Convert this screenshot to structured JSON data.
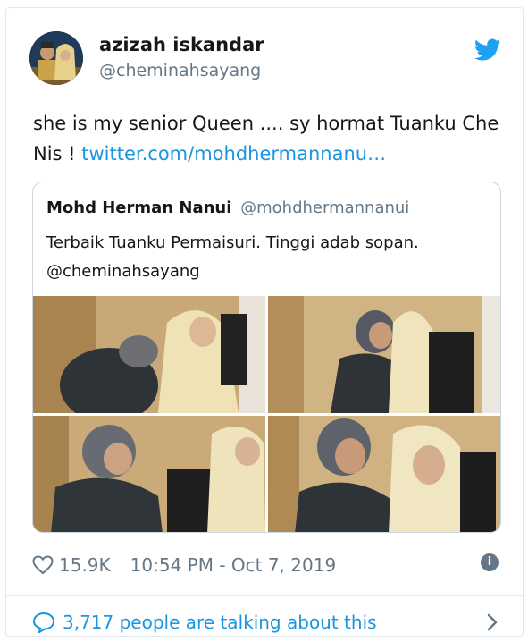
{
  "tweet": {
    "author_name": "azizah iskandar",
    "author_handle": "@cheminahsayang",
    "text": "she is my senior Queen .... sy hormat Tuanku Che Nis ! ",
    "link_text": "twitter.com/mohdhermannanu…",
    "likes": "15.9K",
    "timestamp": "10:54 PM - Oct 7, 2019",
    "talking": "3,717 people are talking about this"
  },
  "quoted_tweet": {
    "author_name": "Mohd Herman Nanui",
    "author_handle": "@mohdhermannanui",
    "text_line1": "Terbaik Tuanku Permaisuri. Tinggi adab sopan.",
    "text_line2": "@cheminahsayang"
  },
  "icons": {
    "brand": "twitter-bird-icon",
    "like": "heart-icon",
    "info": "info-icon",
    "reply": "speech-bubble-icon",
    "next": "chevron-right-icon"
  },
  "colors": {
    "link": "#1b95e0",
    "muted": "#657786",
    "border": "#e1e8ed",
    "text": "#14171a"
  }
}
